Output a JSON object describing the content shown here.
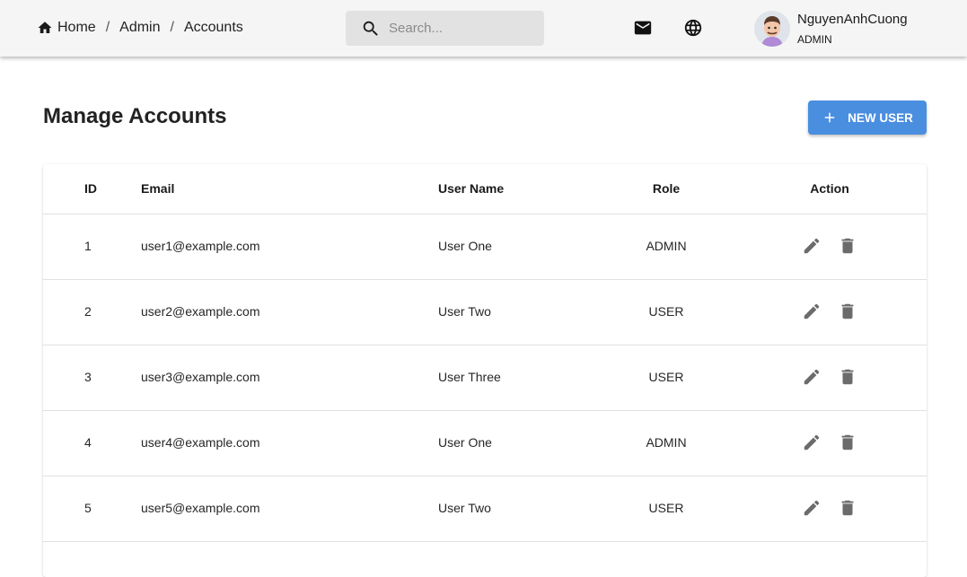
{
  "breadcrumb": {
    "items": [
      "Home",
      "Admin",
      "Accounts"
    ],
    "separator": "/"
  },
  "search": {
    "placeholder": "Search..."
  },
  "header_icons": [
    "mail-icon",
    "globe-icon"
  ],
  "user": {
    "name": "NguyenAnhCuong",
    "role": "ADMIN"
  },
  "page": {
    "title": "Manage Accounts"
  },
  "new_user_button": {
    "label": "NEW USER",
    "icon": "plus-icon"
  },
  "table": {
    "columns": [
      "ID",
      "Email",
      "User Name",
      "Role",
      "Action"
    ],
    "rows": [
      {
        "id": "1",
        "email": "user1@example.com",
        "name": "User One",
        "role": "ADMIN"
      },
      {
        "id": "2",
        "email": "user2@example.com",
        "name": "User Two",
        "role": "USER"
      },
      {
        "id": "3",
        "email": "user3@example.com",
        "name": "User Three",
        "role": "USER"
      },
      {
        "id": "4",
        "email": "user4@example.com",
        "name": "User One",
        "role": "ADMIN"
      },
      {
        "id": "5",
        "email": "user5@example.com",
        "name": "User Two",
        "role": "USER"
      }
    ],
    "row_actions": [
      "edit-icon",
      "delete-icon"
    ]
  },
  "colors": {
    "accent": "#4a8ee0",
    "topbar_bg": "#f4f5f4",
    "search_bg": "#e2e2e2",
    "icon_gray": "#6b6b6b"
  }
}
